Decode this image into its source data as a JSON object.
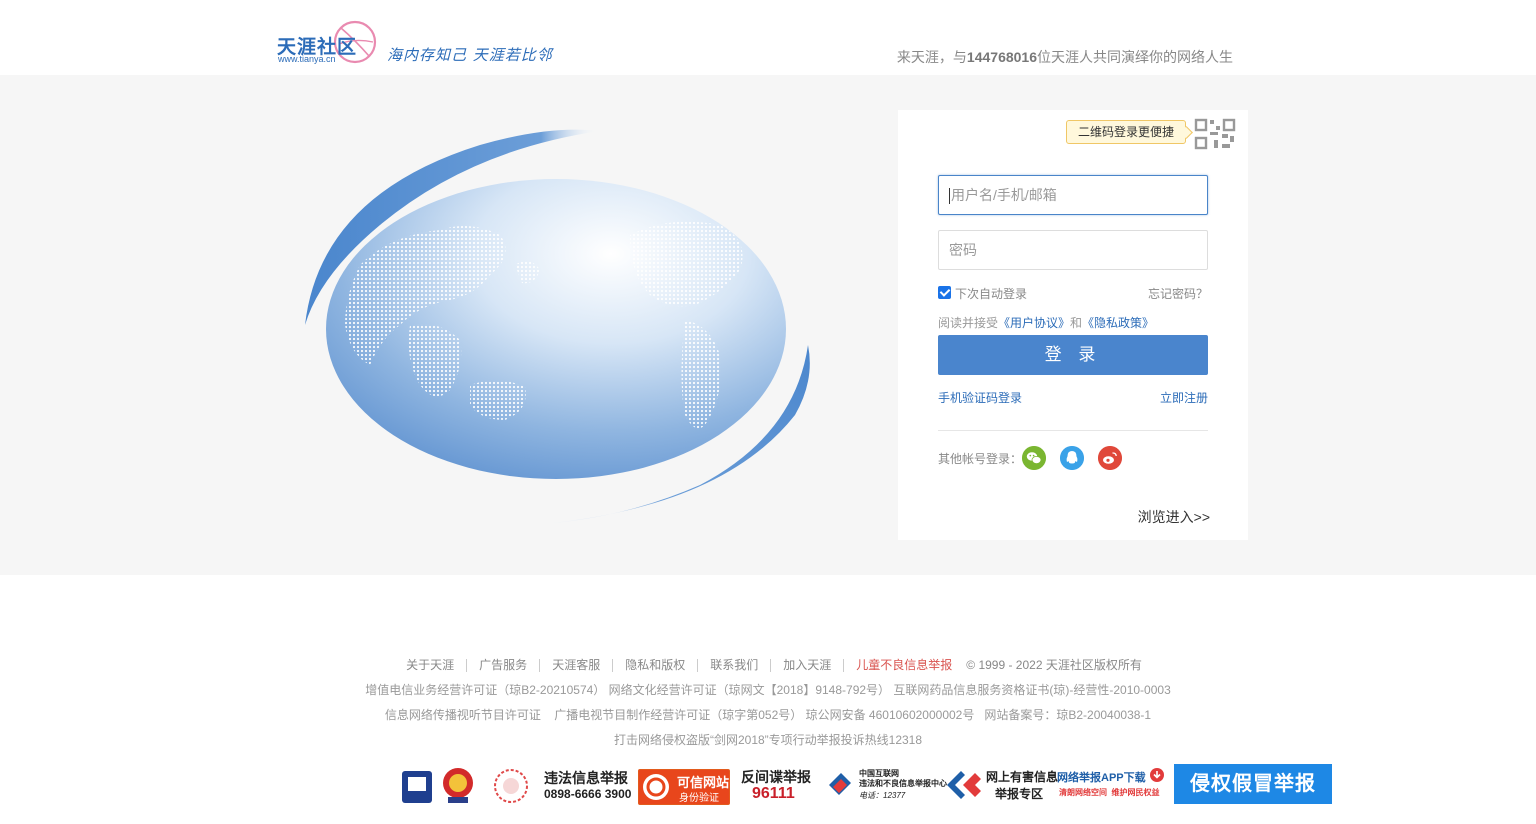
{
  "header": {
    "logo_name": "天涯社区",
    "logo_url": "www.tianya.cn",
    "logo_slogan": "海内存知己 天涯若比邻",
    "tagline_prefix": "来天涯，与",
    "tagline_count": "144768016",
    "tagline_suffix": "位天涯人共同演绎你的网络人生"
  },
  "login": {
    "qr_tip": "二维码登录更便捷",
    "username_placeholder": "用户名/手机/邮箱",
    "password_placeholder": "密码",
    "remember_label": "下次自动登录",
    "remember_checked": true,
    "forgot_label": "忘记密码？",
    "agree_prefix": "阅读并接受",
    "agree_user": "《用户协议》",
    "agree_and": "和",
    "agree_privacy": "《隐私政策》",
    "submit_label": "登 录",
    "sms_login": "手机验证码登录",
    "register": "立即注册",
    "other_label": "其他帐号登录：",
    "browse": "浏览进入>>",
    "accent_color": "#4a85cd"
  },
  "footer": {
    "links": [
      "关于天涯",
      "广告服务",
      "天涯客服",
      "隐私和版权",
      "联系我们",
      "加入天涯"
    ],
    "report_link": "儿童不良信息举报",
    "copyright": "© 1999 - 2022 天涯社区版权所有",
    "line2": "增值电信业务经营许可证（琼B2-20210574） 网络文化经营许可证（琼网文【2018】9148-792号） 互联网药品信息服务资格证书(琼)-经营性-2010-0003",
    "line3": "信息网络传播视听节目许可证    广播电视节目制作经营许可证（琼字第052号） 琼公网安备 46010602000002号   网站备案号：琼B2-20040038-1",
    "line4": "打击网络侵权盗版“剑网2018”专项行动举报投诉热线12318",
    "badges": {
      "illegal_title": "违法信息举报",
      "illegal_phone": "0898-6666 3900",
      "kexin_title": "可信网站",
      "kexin_sub": "身份验证",
      "spy_title": "反间谍举报",
      "spy_phone": "96111",
      "cert_title": "中国互联网",
      "cert_sub": "违法和不良信息举报中心",
      "cert_phone": "电话：12377",
      "harm_title": "网上有害信息",
      "harm_sub": "举报专区",
      "app_title": "网络举报APP下载",
      "app_sub": "清朗网络空间  维护网民权益",
      "infringe": "侵权假冒举报"
    }
  }
}
